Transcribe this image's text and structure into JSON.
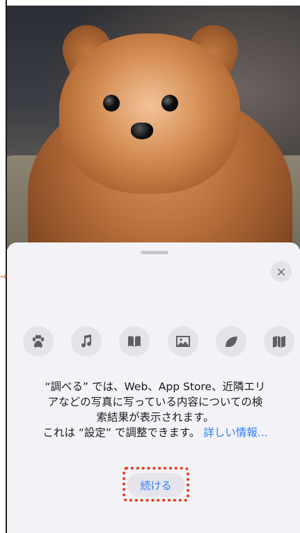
{
  "photo": {
    "subject_icon": "pomeranian-photo"
  },
  "sheet": {
    "close_label": "×",
    "category_icons": [
      "paw-icon",
      "music-note-icon",
      "book-icon",
      "photo-icon",
      "leaf-icon",
      "map-icon"
    ],
    "description_line1": "“調べる” では、Web、App Store、近隣エリ",
    "description_line2": "アなどの写真に写っている内容についての検",
    "description_line3": "索結果が表示されます。",
    "description_line4": "これは “設定” で調整できます。",
    "more_info_link": "詳しい情報...",
    "continue_label": "続ける"
  },
  "annotation": {
    "arrow_glyph": "→",
    "highlight_color": "#e83a12"
  },
  "colors": {
    "accent": "#2f7ef5",
    "sheet_bg": "#f2f2f7",
    "icon_bg": "#e3e3e8"
  }
}
